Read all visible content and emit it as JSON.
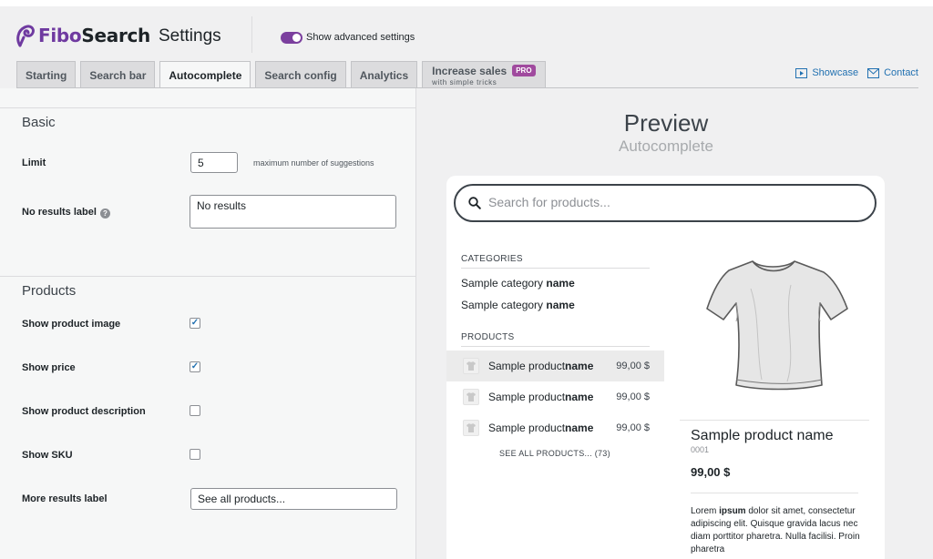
{
  "app": {
    "logo_part1": "Fibo",
    "logo_part2": "Search",
    "page_title": "Settings",
    "advanced_toggle_label": "Show advanced settings",
    "advanced_toggle_on": true,
    "accent_color": "#7b3f9e"
  },
  "tabs": [
    {
      "label": "Starting"
    },
    {
      "label": "Search bar"
    },
    {
      "label": "Autocomplete",
      "active": true
    },
    {
      "label": "Search config"
    },
    {
      "label": "Analytics"
    }
  ],
  "sales_tab": {
    "label": "Increase sales",
    "sublabel": "with simple tricks",
    "badge": "PRO"
  },
  "header_links": {
    "showcase": "Showcase",
    "contact": "Contact"
  },
  "basic": {
    "title": "Basic",
    "limit_label": "Limit",
    "limit_value": "5",
    "limit_hint": "maximum number of suggestions",
    "no_results_label": "No results label",
    "no_results_help": "?",
    "no_results_value": "No results"
  },
  "products": {
    "title": "Products",
    "show_image_label": "Show product image",
    "show_image_check": "✓",
    "show_price_label": "Show price",
    "show_price_check": "✓",
    "show_description_label": "Show product description",
    "show_sku_label": "Show SKU",
    "more_results_label": "More results label",
    "more_results_value": "See all products..."
  },
  "preview": {
    "title": "Preview",
    "subtitle": "Autocomplete",
    "search_placeholder": "Search for products...",
    "categories_heading": "CATEGORIES",
    "categories": [
      {
        "prefix": "Sample category ",
        "bold": "name"
      },
      {
        "prefix": "Sample category ",
        "bold": "name"
      }
    ],
    "products_heading": "PRODUCTS",
    "products": [
      {
        "prefix": "Sample product ",
        "bold": "name",
        "price": "99,00 $"
      },
      {
        "prefix": "Sample product ",
        "bold": "name",
        "price": "99,00 $"
      },
      {
        "prefix": "Sample product ",
        "bold": "name",
        "price": "99,00 $"
      }
    ],
    "see_all": "SEE ALL PRODUCTS... (73)",
    "detail": {
      "name": "Sample product name",
      "sku": "0001",
      "price": "99,00 $",
      "desc_1": "Lorem ",
      "desc_bold": "ipsum",
      "desc_2": " dolor sit amet, consectetur adipiscing elit. Quisque gravida lacus nec diam porttitor pharetra. Nulla facilisi. Proin pharetra"
    }
  }
}
